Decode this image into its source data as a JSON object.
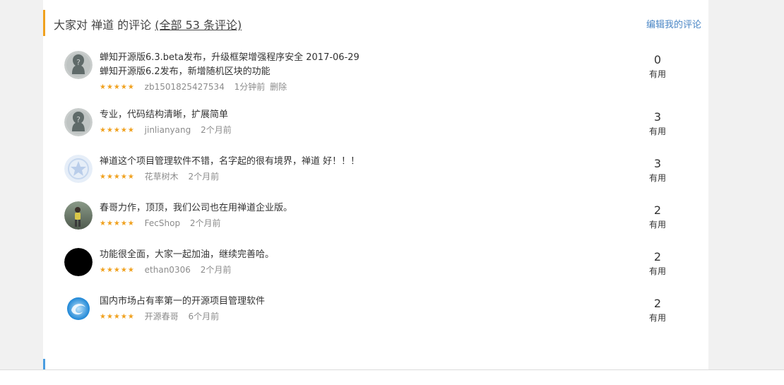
{
  "reviews_section": {
    "title_prefix": "大家对 禅道 的评论",
    "title_count": "(全部 53 条评论)",
    "edit_link": "编辑我的评论"
  },
  "reviews": [
    {
      "line1": "蝉知开源版6.3.beta发布，升级框架增强程序安全 2017-06-29",
      "line2": "蝉知开源版6.2发布，新增随机区块的功能",
      "stars": "★★★★★",
      "user": "zb1501825427534",
      "time": "1分钟前",
      "delete": "删除",
      "useful_count": "0",
      "useful_label": "有用",
      "avatar": "default-silhouette-icon"
    },
    {
      "line1": "专业，代码结构清晰，扩展简单",
      "stars": "★★★★★",
      "user": "jinlianyang",
      "time": "2个月前",
      "useful_count": "3",
      "useful_label": "有用",
      "avatar": "default-silhouette-icon"
    },
    {
      "line1": "禅道这个项目管理软件不错，名字起的很有境界，禅道 好！！！",
      "stars": "★★★★★",
      "user": "花草树木",
      "time": "2个月前",
      "useful_count": "3",
      "useful_label": "有用",
      "avatar": "light-blue-star-avatar"
    },
    {
      "line1": "春哥力作，顶顶，我们公司也在用禅道企业版。",
      "stars": "★★★★★",
      "user": "FecShop",
      "time": "2个月前",
      "useful_count": "2",
      "useful_label": "有用",
      "avatar": "photo-person-avatar"
    },
    {
      "line1": "功能很全面，大家一起加油，继续完善哈。",
      "stars": "★★★★★",
      "user": "ethan0306",
      "time": "2个月前",
      "useful_count": "2",
      "useful_label": "有用",
      "avatar": "black-circle-avatar"
    },
    {
      "line1": "国内市场占有率第一的开源项目管理软件",
      "stars": "★★★★★",
      "user": "开源春哥",
      "time": "6个月前",
      "useful_count": "2",
      "useful_label": "有用",
      "avatar": "blue-swirl-avatar"
    }
  ],
  "colors": {
    "accent_orange": "#f0a11e",
    "accent_blue": "#4a9de0",
    "link_blue": "#4a86c5"
  }
}
